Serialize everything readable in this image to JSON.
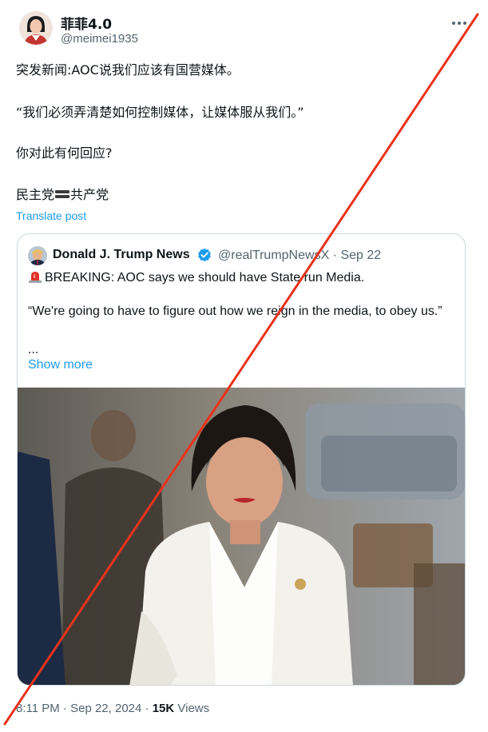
{
  "author": {
    "display_name": "菲菲4.0",
    "handle": "@meimei1935"
  },
  "post": {
    "line1": "突发新闻:AOC说我们应该有国营媒体。",
    "line2": "“我们必须弄清楚如何控制媒体，让媒体服从我们。”",
    "line3": "你对此有何回应?",
    "line4_left": "民主党",
    "line4_right": "共产党",
    "translate_label": "Translate post"
  },
  "quoted": {
    "display_name": "Donald J. Trump News",
    "meta": "@realTrumpNewsX · Sep 22",
    "line1": "BREAKING: AOC says we should have State run Media.",
    "line2": "“We're going to have to figure out how we reign in the media, to obey us.”",
    "line3": "...",
    "show_more": "Show more"
  },
  "footer": {
    "time": "8:11 PM",
    "sep1": " · ",
    "date": "Sep 22, 2024",
    "sep2": " · ",
    "views_count": "15K",
    "views_label": " Views"
  },
  "colors": {
    "link": "#1d9bf0",
    "secondary_text": "#536471",
    "strike_line": "#e8331c",
    "verified": "#1d9bf0"
  },
  "icons": {
    "more": "more-icon",
    "verified": "verified-badge-icon",
    "siren": "siren-emoji-icon",
    "equals": "heavy-equals-emoji-icon"
  }
}
